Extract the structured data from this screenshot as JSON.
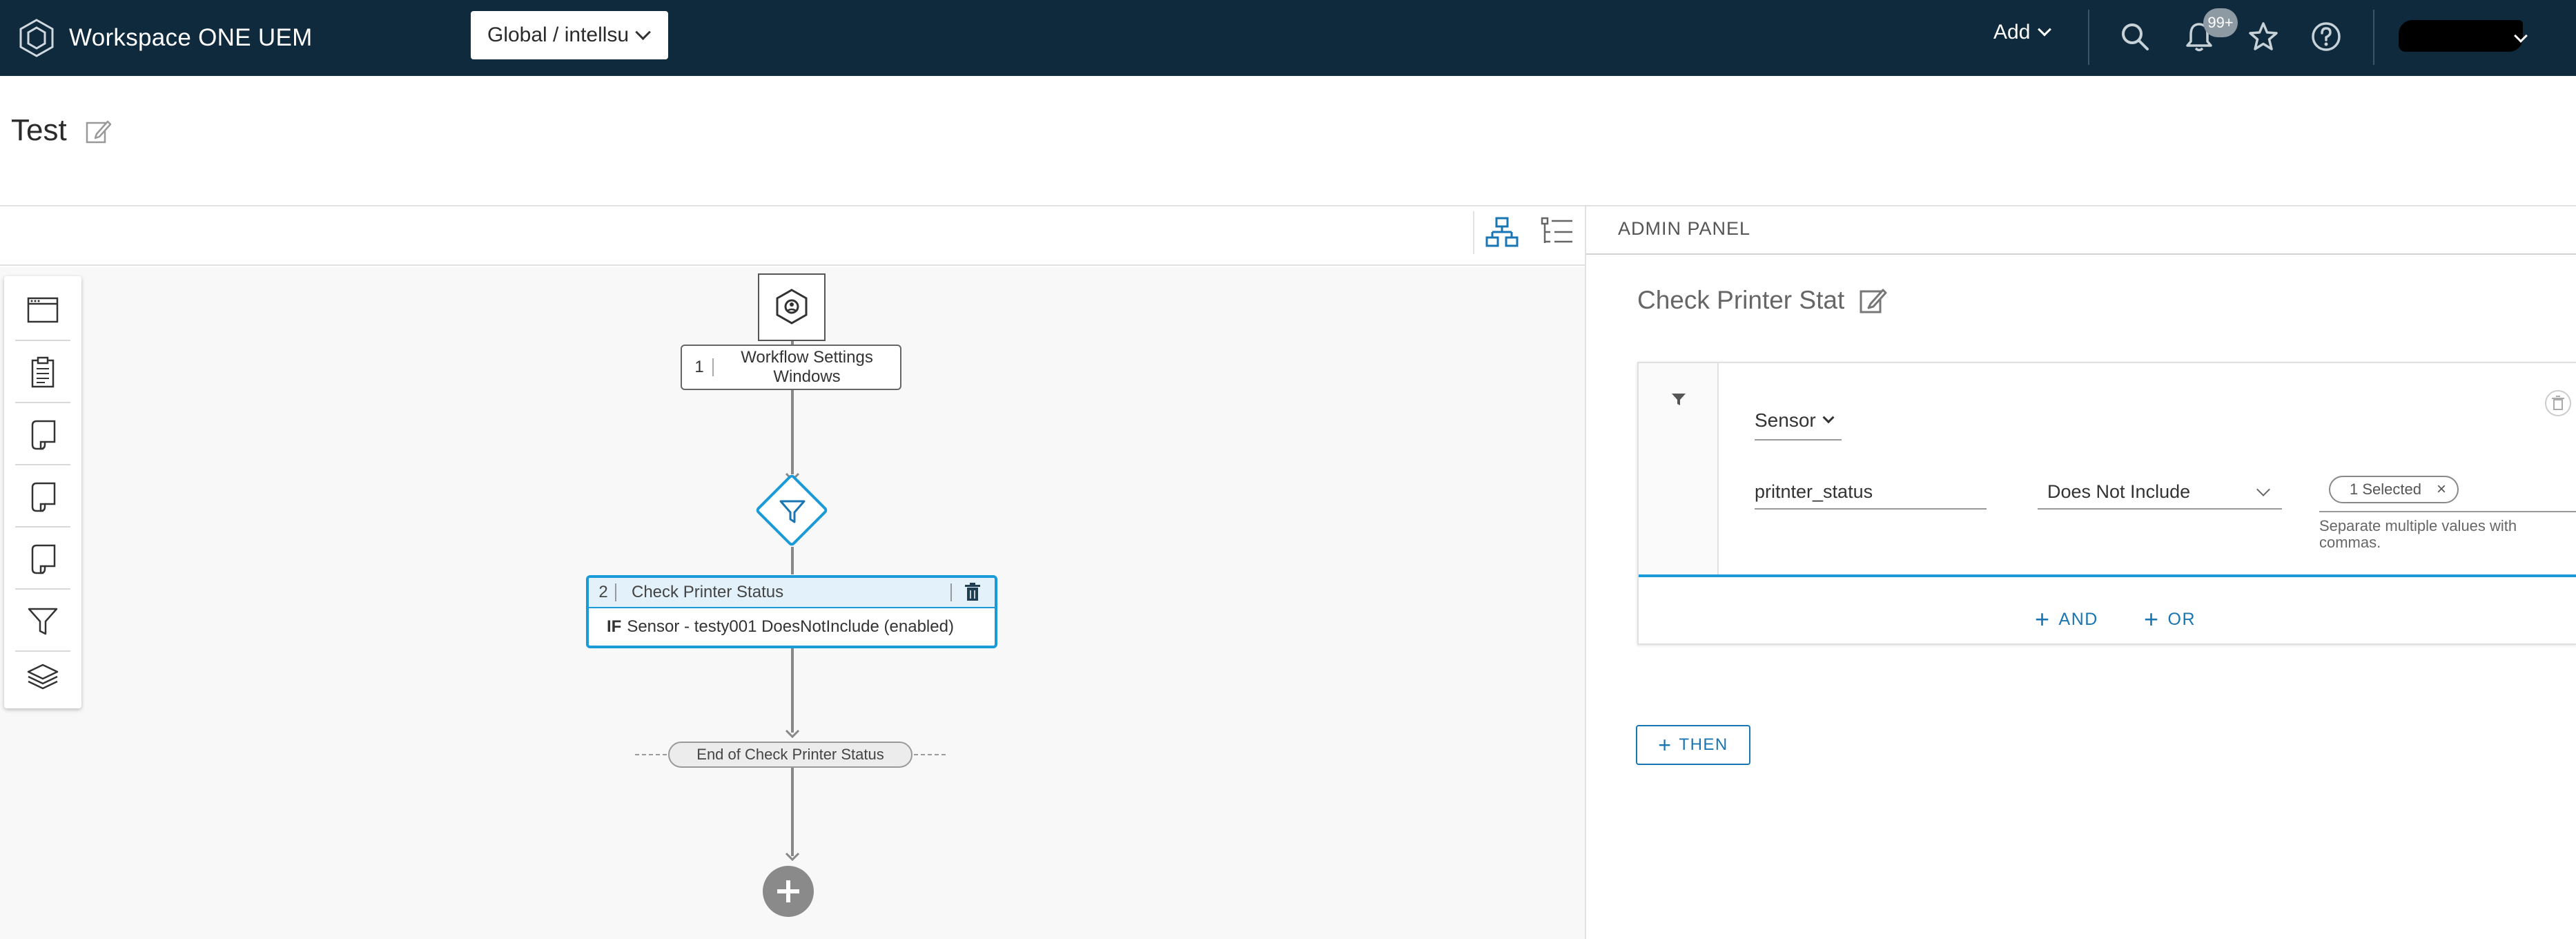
{
  "header": {
    "app_name": "Workspace ONE UEM",
    "org_selector": "Global / intellsu",
    "add_label": "Add",
    "notification_count": "99+",
    "icons": [
      "logo-icon",
      "search-icon",
      "bell-icon",
      "star-icon",
      "help-icon"
    ],
    "colors": {
      "bar": "#0f2a3d",
      "accent": "#1a9bd7"
    }
  },
  "page": {
    "title": "Test"
  },
  "canvas": {
    "palette": [
      "window-icon",
      "clipboard-icon",
      "script-icon",
      "script-icon",
      "script-icon",
      "filter-icon",
      "layers-icon"
    ],
    "settings_node": {
      "number": "1",
      "label": "Workflow Settings Windows"
    },
    "condition_node": {
      "number": "2",
      "name": "Check Printer Status",
      "if_keyword": "IF",
      "expression": "Sensor - testy001 DoesNotInclude (enabled)"
    },
    "end_node": "End of Check Printer Status"
  },
  "admin_panel": {
    "tab_label": "ADMIN PANEL",
    "title": "Check Printer Stat",
    "rule": {
      "source": "Sensor",
      "attribute": "pritnter_status",
      "operator": "Does Not Include",
      "selected_chip": "1 Selected",
      "help_text": "Separate multiple values with commas."
    },
    "and_label": "AND",
    "or_label": "OR",
    "then_label": "THEN"
  }
}
